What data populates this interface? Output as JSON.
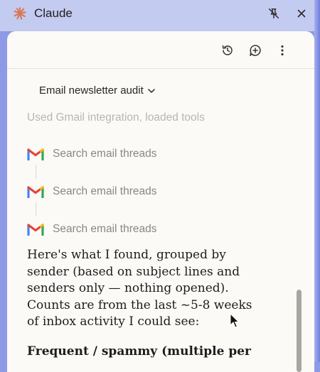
{
  "window": {
    "app_title": "Claude"
  },
  "conversation": {
    "title": "Email newsletter audit"
  },
  "activity": {
    "summary": "Used Gmail integration, loaded tools",
    "steps": [
      {
        "label": "Search email threads",
        "icon": "gmail-icon"
      },
      {
        "label": "Search email threads",
        "icon": "gmail-icon"
      },
      {
        "label": "Search email threads",
        "icon": "gmail-icon"
      }
    ]
  },
  "message": {
    "body": "Here's what I found, grouped by sender (based on subject lines and senders only — nothing opened). Counts are from the last ~5-8 weeks of inbox activity I could see:",
    "section_heading": "Frequent / spammy (multiple per"
  },
  "colors": {
    "accent": "#d97757",
    "titlebar": "#c3cbf0",
    "panel": "#fbfaf7",
    "gmail_red": "#ea4335",
    "gmail_blue": "#4285f4",
    "gmail_green": "#34a853",
    "gmail_yellow": "#fbbc04"
  }
}
